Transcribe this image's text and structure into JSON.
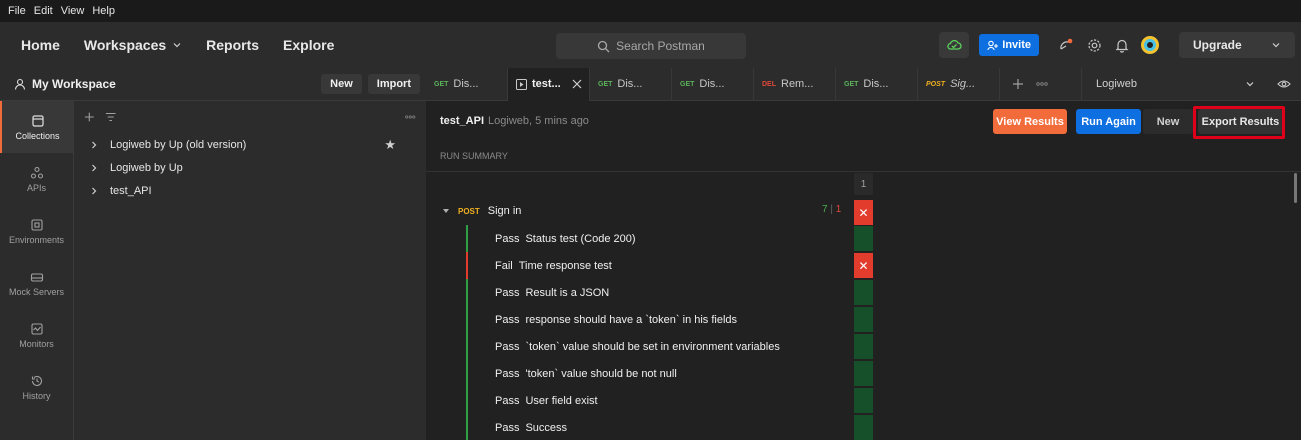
{
  "menu": [
    "File",
    "Edit",
    "View",
    "Help"
  ],
  "nav": {
    "home": "Home",
    "workspaces": "Workspaces",
    "reports": "Reports",
    "explore": "Explore"
  },
  "search": {
    "placeholder": "Search Postman"
  },
  "header": {
    "invite": "Invite",
    "upgrade": "Upgrade"
  },
  "workspace": {
    "title": "My Workspace",
    "new_label": "New",
    "import_label": "Import"
  },
  "iconbar": [
    {
      "label": "Collections",
      "icon": "collections-icon"
    },
    {
      "label": "APIs",
      "icon": "apis-icon"
    },
    {
      "label": "Environments",
      "icon": "environments-icon"
    },
    {
      "label": "Mock Servers",
      "icon": "mock-servers-icon"
    },
    {
      "label": "Monitors",
      "icon": "monitors-icon"
    },
    {
      "label": "History",
      "icon": "history-icon"
    }
  ],
  "collections": [
    {
      "name": "Logiweb by Up (old version)",
      "starred": true
    },
    {
      "name": "Logiweb by Up",
      "starred": false
    },
    {
      "name": "test_API",
      "starred": false
    }
  ],
  "tabs": [
    {
      "method": "GET",
      "name": "Dis..."
    },
    {
      "method": "",
      "name": "test...",
      "active": true
    },
    {
      "method": "GET",
      "name": "Dis..."
    },
    {
      "method": "GET",
      "name": "Dis..."
    },
    {
      "method": "DEL",
      "name": "Rem..."
    },
    {
      "method": "GET",
      "name": "Dis..."
    },
    {
      "method": "POST",
      "name": "Sig..."
    }
  ],
  "environment": {
    "selected": "Logiweb"
  },
  "run": {
    "name": "test_API",
    "meta": "Logiweb, 5 mins ago",
    "summary_label": "RUN SUMMARY",
    "column": "1",
    "actions": {
      "view_results": "View Results",
      "run_again": "Run Again",
      "new": "New",
      "export_results": "Export Results"
    },
    "request": {
      "method": "POST",
      "name": "Sign in",
      "passed": "7",
      "failed": "1"
    },
    "tests": [
      {
        "status": "Pass",
        "name": "Status test (Code 200)"
      },
      {
        "status": "Fail",
        "name": "Time response test"
      },
      {
        "status": "Pass",
        "name": "Result is a JSON"
      },
      {
        "status": "Pass",
        "name": "response should have a `token` in his fields"
      },
      {
        "status": "Pass",
        "name": "`token` value should be set in environment variables"
      },
      {
        "status": "Pass",
        "name": "'token` value should be not null"
      },
      {
        "status": "Pass",
        "name": "User field exist"
      },
      {
        "status": "Pass",
        "name": "Success"
      }
    ]
  },
  "colors": {
    "accent_orange": "#f26b3a",
    "blue": "#0d6fe0",
    "pass": "#4caf50",
    "fail": "#e23c2d",
    "highlight": "#e0001a"
  }
}
